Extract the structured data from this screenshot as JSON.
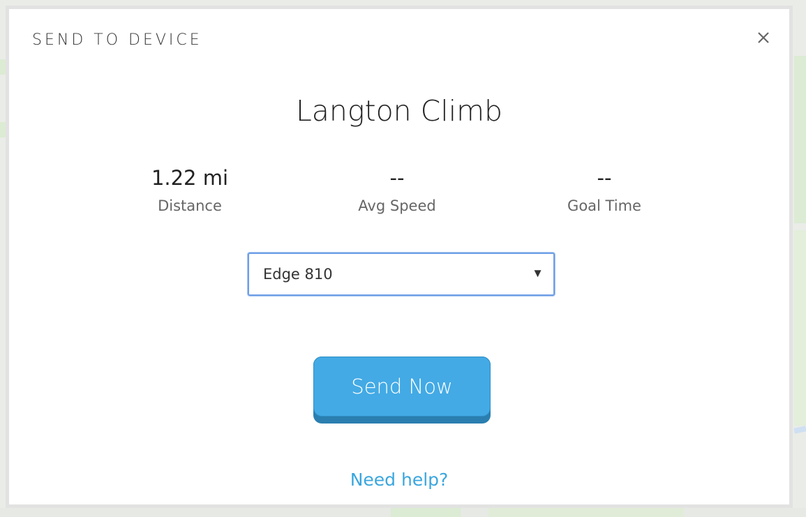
{
  "modal": {
    "header": "SEND TO DEVICE",
    "route_name": "Langton Climb",
    "stats": [
      {
        "value": "1.22 mi",
        "label": "Distance"
      },
      {
        "value": "--",
        "label": "Avg Speed"
      },
      {
        "value": "--",
        "label": "Goal Time"
      }
    ],
    "device_select": {
      "selected": "Edge 810",
      "caret": "▼"
    },
    "send_button": "Send Now",
    "help_link": "Need help?"
  },
  "colors": {
    "accent": "#43aae5",
    "link": "#3aa6de",
    "select_border": "#6e9fe6"
  },
  "icons": {
    "close": "close-icon"
  }
}
